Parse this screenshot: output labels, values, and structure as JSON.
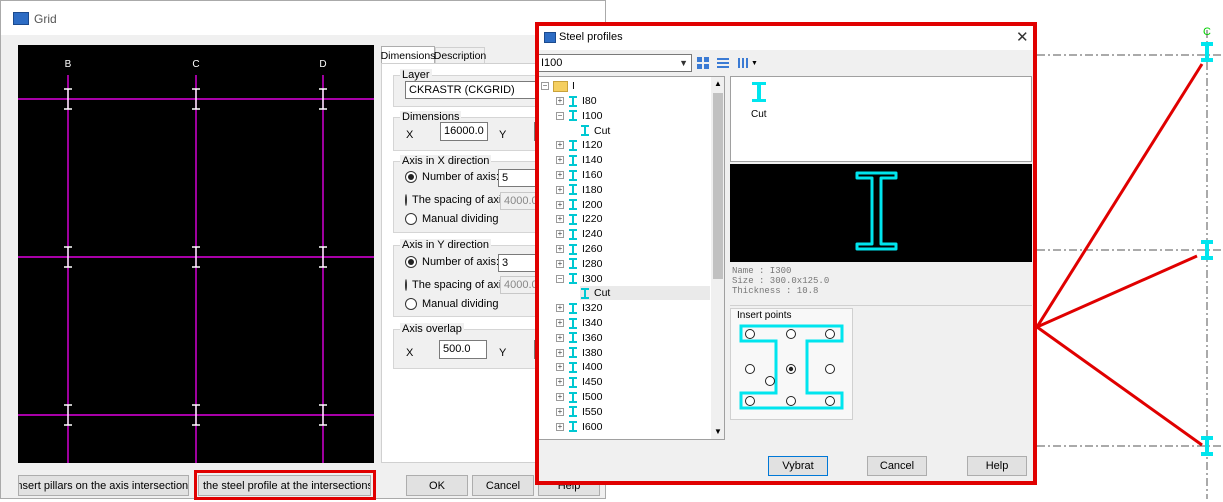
{
  "grid_dialog": {
    "title": "Grid",
    "axis_labels": [
      "B",
      "C",
      "D"
    ],
    "tabs": [
      "Dimensions",
      "Description"
    ],
    "layer": {
      "group_label": "Layer",
      "value": "CKRASTR (CKGRID)"
    },
    "dimensions": {
      "group_label": "Dimensions",
      "x_label": "X",
      "x_value": "16000.0",
      "y_label": "Y"
    },
    "axis_x": {
      "group_label": "Axis in X direction",
      "number_label": "Number of axis:",
      "number_value": "5",
      "spacing_label": "The spacing of axis",
      "spacing_value": "4000.0",
      "manual_label": "Manual dividing",
      "selected": "number"
    },
    "axis_y": {
      "group_label": "Axis in Y direction",
      "number_label": "Number of axis:",
      "number_value": "3",
      "spacing_label": "The spacing of axis",
      "spacing_value": "4000.0",
      "manual_label": "Manual dividing",
      "selected": "number"
    },
    "overlap": {
      "group_label": "Axis overlap",
      "x_label": "X",
      "x_value": "500.0",
      "y_label": "Y"
    },
    "buttons": {
      "insert_pillars": "Insert pillars on the axis intersections",
      "insert_steel": "the steel profile at the intersections of the",
      "ok": "OK",
      "cancel": "Cancel",
      "help": "Help"
    },
    "colors": {
      "grid_line": "#e000e0",
      "canvas": "#000000"
    }
  },
  "steel_dialog": {
    "title": "Steel profiles",
    "selected_profile": "I100",
    "root_label": "I",
    "tree_items": [
      "I80",
      "I100",
      "Cut",
      "I120",
      "I140",
      "I160",
      "I180",
      "I200",
      "I220",
      "I240",
      "I260",
      "I280",
      "I300",
      "Cut",
      "I320",
      "I340",
      "I360",
      "I380",
      "I400",
      "I450",
      "I500",
      "I550",
      "I600"
    ],
    "preview_top_label": "Cut",
    "info": {
      "name": "Name : I300",
      "size": "Size : 300.0x125.0",
      "thickness": "Thickness : 10.8"
    },
    "insert_points_label": "Insert points",
    "insert_point_selected": "center",
    "buttons": {
      "select": "Vybrat",
      "cancel": "Cancel",
      "help": "Help"
    },
    "colors": {
      "profile": "#00e5ee",
      "highlight_frame": "#e00000"
    }
  },
  "right_canvas": {
    "axis_label": "C",
    "axis_label_color": "#00d000"
  }
}
